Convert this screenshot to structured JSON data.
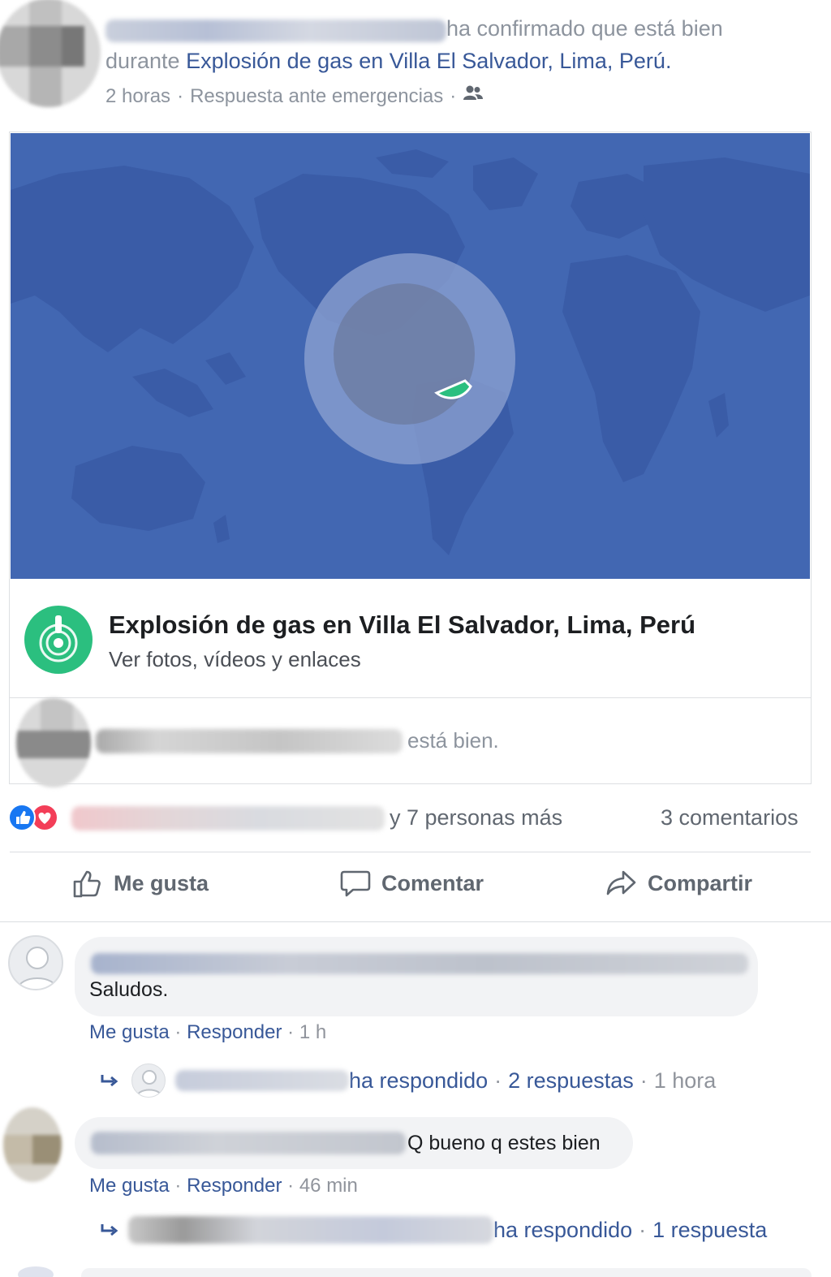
{
  "post": {
    "header_text": "ha confirmado que está bien",
    "during_prefix": "durante ",
    "event_link": "Explosión de gas en Villa El Salvador, Lima, Perú",
    "period": ".",
    "time": "2 horas",
    "sep": "·",
    "category": "Respuesta ante emergencias",
    "audience_icon": "friends-icon"
  },
  "event_card": {
    "title": "Explosión de gas en Villa El Salvador, Lima, Perú",
    "subtitle": "Ver fotos, vídeos y enlaces",
    "icon": "crisis-response-icon",
    "safe_text": "está bien.",
    "colors": {
      "map": "#4267b2",
      "land": "#3a5ca7",
      "crisis_green": "#2bbf7f"
    }
  },
  "reactions": {
    "others": "y 7 personas más",
    "comments": "3 comentarios"
  },
  "actions": {
    "like": "Me gusta",
    "comment": "Comentar",
    "share": "Compartir"
  },
  "comments": [
    {
      "text": "Saludos.",
      "like": "Me gusta",
      "reply": "Responder",
      "sep": "·",
      "time": "1 h",
      "replied_text": "ha respondido",
      "replies": "2 respuestas",
      "reply_time": "1 hora"
    },
    {
      "text": "Q bueno q estes bien",
      "like": "Me gusta",
      "reply": "Responder",
      "sep": "·",
      "time": "46 min",
      "replied_text": "ha respondido",
      "replies": "1 respuesta"
    }
  ]
}
